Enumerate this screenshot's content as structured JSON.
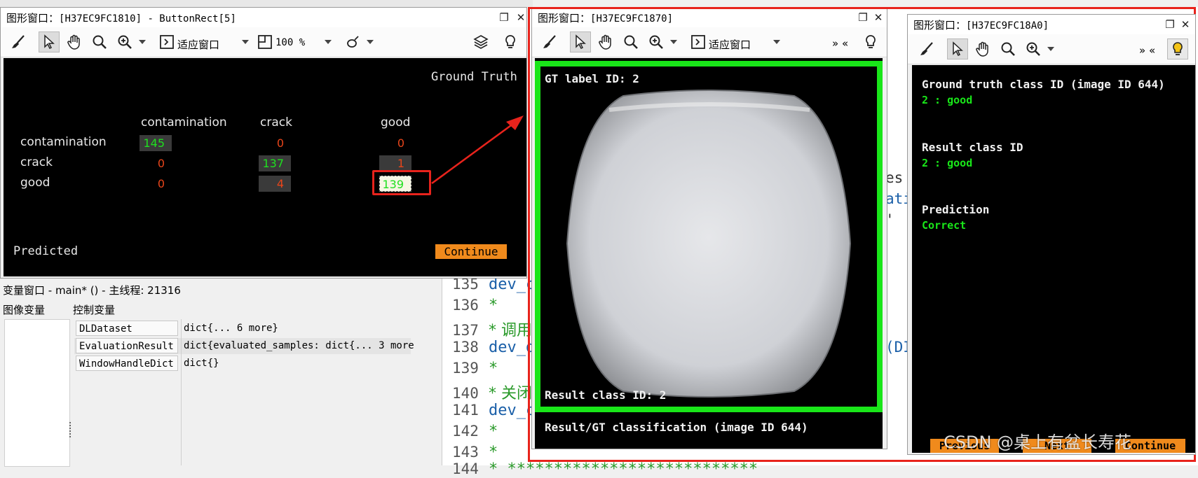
{
  "win1": {
    "title": "图形窗口：",
    "title_id": "[H37EC9FC1810] - ButtonRect[5]",
    "zoom_label": "适应窗口",
    "zoom_value": "100 %",
    "matrix": {
      "header_right": "Ground Truth",
      "columns": [
        "contamination",
        "crack",
        "good"
      ],
      "rows": [
        {
          "label": "contamination",
          "values": [
            "145",
            "0",
            "0"
          ]
        },
        {
          "label": "crack",
          "values": [
            "0",
            "137",
            "1"
          ]
        },
        {
          "label": "good",
          "values": [
            "0",
            "4",
            "139"
          ]
        }
      ],
      "footer_left": "Predicted",
      "continue": "Continue"
    }
  },
  "variables": {
    "title": "变量窗口 - main* () - 主线程: 21316",
    "tab_image": "图像变量",
    "tab_control": "控制变量",
    "rows": [
      {
        "name": "DLDataset",
        "value": "dict{... 6 more}"
      },
      {
        "name": "EvaluationResult",
        "value": "dict{evaluated_samples: dict{... 3 more"
      },
      {
        "name": "WindowHandleDict",
        "value": "dict{}"
      }
    ]
  },
  "code": {
    "lines": [
      {
        "num": "135",
        "text": "dev_c"
      },
      {
        "num": "136",
        "text": "*"
      },
      {
        "num": "137",
        "text": "* 调用"
      },
      {
        "num": "138",
        "text": "dev_d"
      },
      {
        "num": "139",
        "text": "*"
      },
      {
        "num": "140",
        "text": "* 关闭"
      },
      {
        "num": "141",
        "text": "dev_c"
      },
      {
        "num": "142",
        "text": "*"
      },
      {
        "num": "143",
        "text": "*"
      },
      {
        "num": "144",
        "text": "* ***************************"
      }
    ],
    "fragments": [
      "es",
      "ati",
      "'",
      "(DI"
    ]
  },
  "win2": {
    "title": "图形窗口：",
    "title_id": "[H37EC9FC1870]",
    "zoom_label": "适应窗口",
    "gt_label": "GT label ID: 2",
    "result_label": "Result class ID: 2",
    "footer": "Result/GT classification (image ID 644)"
  },
  "win3": {
    "title": "图形窗口：",
    "title_id": "[H37EC9FC18A0]",
    "gt_heading": "Ground truth class ID (image ID 644)",
    "gt_value": "2 : good",
    "result_heading": "Result class ID",
    "result_value": "2 : good",
    "prediction_heading": "Prediction",
    "prediction_value": "Correct",
    "btn_previous": "Previous",
    "btn_next": "Next",
    "btn_continue": "Continue"
  },
  "watermark": "CSDN @桌上有盆长寿花",
  "colors": {
    "accent_green": "#19e619",
    "value_red": "#e8451a",
    "annotation_red": "#e8231c",
    "button_orange": "#f08a1c",
    "code_blue": "#1a5fa8",
    "comment_green": "#2a9a2a"
  }
}
